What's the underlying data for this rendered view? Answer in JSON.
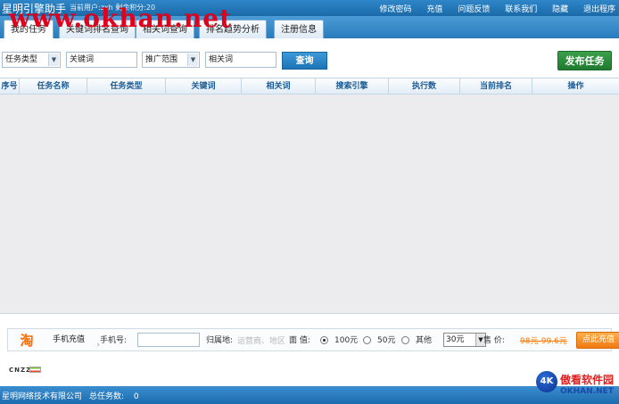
{
  "window": {
    "app_name": "星明引擎助手",
    "user_info": "当前用户:zxh  剩余积分:20",
    "top_links": [
      "修改密码",
      "充值",
      "问题反馈",
      "联系我们",
      "隐藏",
      "退出程序"
    ]
  },
  "watermark": "www.okhan.net",
  "tabs": [
    {
      "label": "我的任务"
    },
    {
      "label": "关键词排名查询"
    },
    {
      "label": "相关词查询"
    },
    {
      "label": "排名趋势分析"
    },
    {
      "label": "注册信息"
    }
  ],
  "filters": {
    "task_type": "任务类型",
    "keyword_placeholder": "关键词",
    "scope": "推广范围",
    "related_placeholder": "相关词",
    "query_button": "查询",
    "publish_button": "发布任务"
  },
  "table": {
    "columns": [
      "序号",
      "任务名称",
      "任务类型",
      "关键词",
      "相关词",
      "搜索引擎",
      "执行数",
      "当前排名",
      "操作"
    ],
    "rows": []
  },
  "recharge": {
    "title": "手机充值",
    "phone_label": "手机号:",
    "region_label": "归属地:",
    "region_placeholder": "运营商、地区",
    "face_label": "面  值:",
    "options": [
      "100元",
      "50元",
      "其他"
    ],
    "selected_option": "100元",
    "other_value": "30元",
    "price_label": "售  价:",
    "price_value": "98元-99.6元",
    "button": "点此充值"
  },
  "cnzz": "CNZZ",
  "status": {
    "company": "星明网络技术有限公司",
    "task_count_label": "总任务数:",
    "task_count": "0"
  },
  "logo": {
    "mark": "4K",
    "cn": "傲看软件园",
    "en": "OKHAN.NET"
  }
}
